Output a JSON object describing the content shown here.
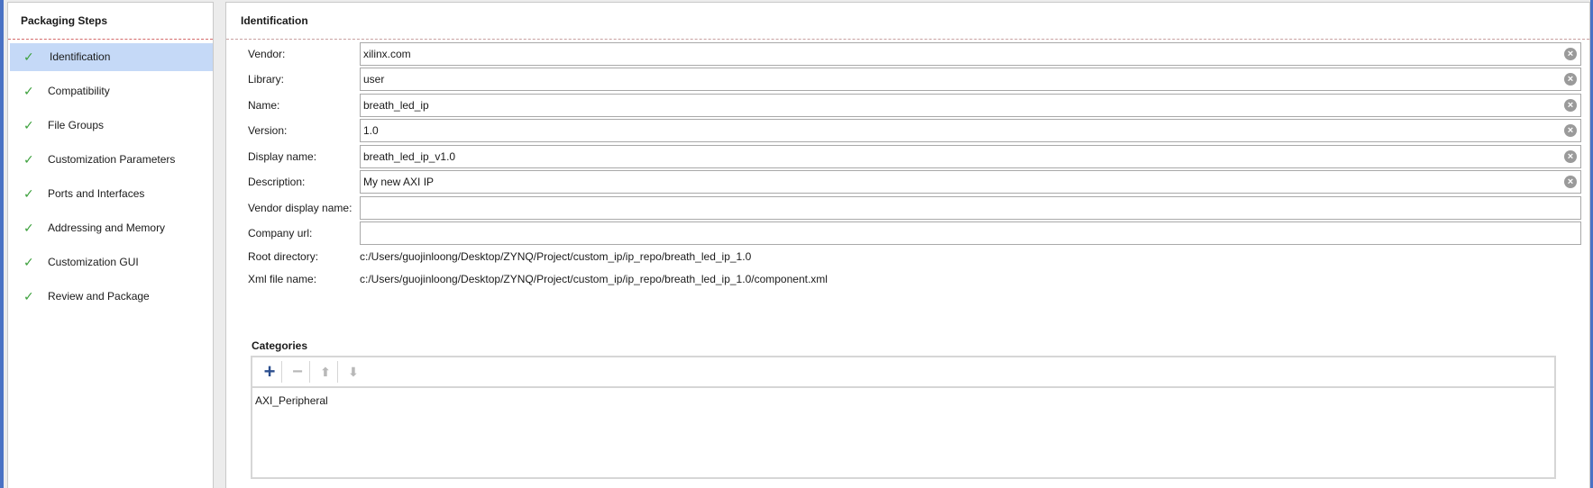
{
  "left_pane": {
    "title": "Packaging Steps",
    "steps": [
      {
        "label": "Identification",
        "selected": true
      },
      {
        "label": "Compatibility",
        "selected": false
      },
      {
        "label": "File Groups",
        "selected": false
      },
      {
        "label": "Customization Parameters",
        "selected": false
      },
      {
        "label": "Ports and Interfaces",
        "selected": false
      },
      {
        "label": "Addressing and Memory",
        "selected": false
      },
      {
        "label": "Customization GUI",
        "selected": false
      },
      {
        "label": "Review and Package",
        "selected": false
      }
    ],
    "check_icon": "✓"
  },
  "right_pane": {
    "title": "Identification",
    "fields": {
      "vendor": {
        "label": "Vendor:",
        "value": "xilinx.com"
      },
      "library": {
        "label": "Library:",
        "value": "user"
      },
      "name": {
        "label": "Name:",
        "value": "breath_led_ip"
      },
      "version": {
        "label": "Version:",
        "value": "1.0"
      },
      "display_name": {
        "label": "Display name:",
        "value": "breath_led_ip_v1.0"
      },
      "description": {
        "label": "Description:",
        "value": "My new AXI IP"
      },
      "vendor_display_name": {
        "label": "Vendor display name:",
        "value": ""
      },
      "company_url": {
        "label": "Company url:",
        "value": ""
      }
    },
    "root_directory": {
      "label": "Root directory:",
      "value": "c:/Users/guojinloong/Desktop/ZYNQ/Project/custom_ip/ip_repo/breath_led_ip_1.0"
    },
    "xml_file_name": {
      "label": "Xml file name:",
      "value": "c:/Users/guojinloong/Desktop/ZYNQ/Project/custom_ip/ip_repo/breath_led_ip_1.0/component.xml"
    },
    "categories": {
      "title": "Categories",
      "items": [
        "AXI_Peripheral"
      ],
      "toolbar": {
        "add_icon": "+",
        "remove_icon": "−",
        "up_icon": "⬆",
        "down_icon": "⬇"
      }
    },
    "clear_icon": "×"
  }
}
